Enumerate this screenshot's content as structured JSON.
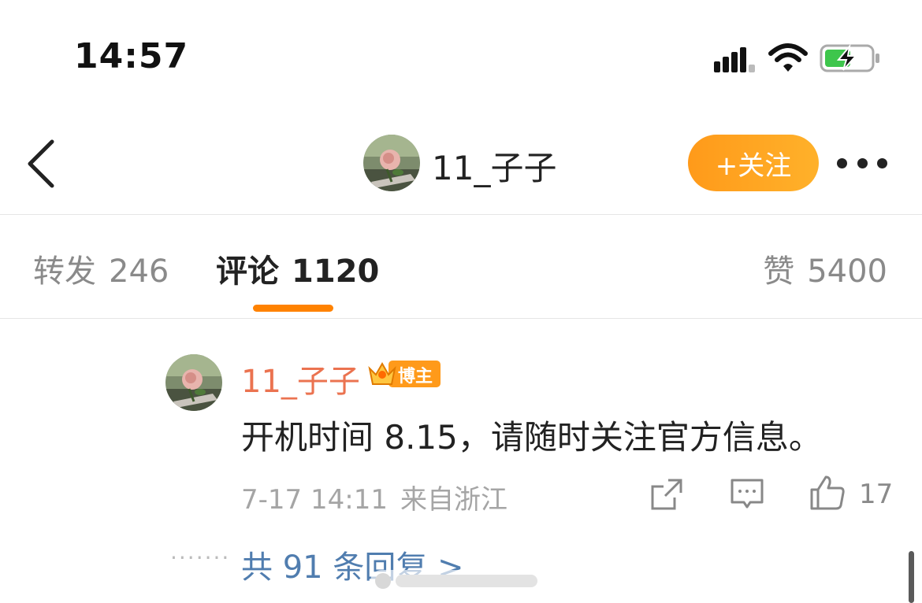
{
  "status_bar": {
    "time": "14:57"
  },
  "nav": {
    "username": "11_子子",
    "follow_label": "+关注"
  },
  "tabs": [
    {
      "label": "转发",
      "count": "246"
    },
    {
      "label": "评论",
      "count": "1120"
    },
    {
      "label": "赞",
      "count": "5400"
    }
  ],
  "comment": {
    "username": "11_子子",
    "badge": "博主",
    "text": "开机时间 8.15，请随时关注官方信息。",
    "time": "7-17 14:11",
    "location": "来自浙江",
    "like_count": "17",
    "replies_label": "共 91 条回复 >"
  },
  "colors": {
    "accent": "#ff8200",
    "username": "#eb7350",
    "link": "#507daf"
  }
}
